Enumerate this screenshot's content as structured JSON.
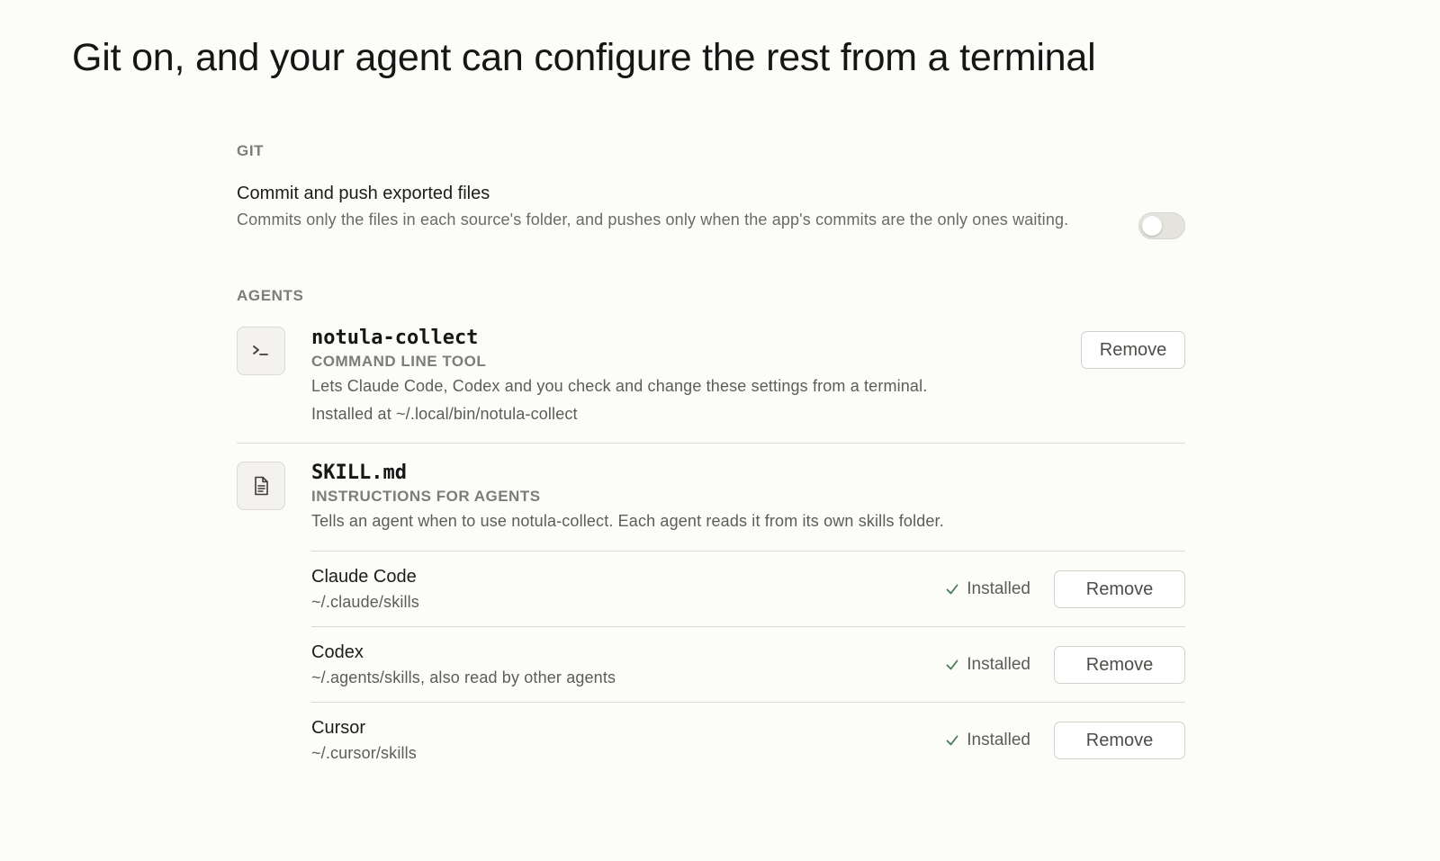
{
  "page": {
    "title": "Git on, and your agent can configure the rest from a terminal"
  },
  "git": {
    "section_label": "GIT",
    "setting_title": "Commit and push exported files",
    "setting_description": "Commits only the files in each source's folder, and pushes only when the app's commits are the only ones waiting.",
    "toggle_on": false
  },
  "agents": {
    "section_label": "AGENTS",
    "cli": {
      "icon": "terminal-icon",
      "name": "notula-collect",
      "subtitle": "COMMAND LINE TOOL",
      "description": "Lets Claude Code, Codex and you check and change these settings from a terminal.",
      "path": "Installed at ~/.local/bin/notula-collect",
      "remove_label": "Remove"
    },
    "skill": {
      "icon": "document-icon",
      "name": "SKILL.md",
      "subtitle": "INSTRUCTIONS FOR AGENTS",
      "description": "Tells an agent when to use notula-collect. Each agent reads it from its own skills folder.",
      "targets": [
        {
          "name": "Claude Code",
          "path": "~/.claude/skills",
          "status": "Installed",
          "remove_label": "Remove"
        },
        {
          "name": "Codex",
          "path": "~/.agents/skills, also read by other agents",
          "status": "Installed",
          "remove_label": "Remove"
        },
        {
          "name": "Cursor",
          "path": "~/.cursor/skills",
          "status": "Installed",
          "remove_label": "Remove"
        }
      ]
    }
  },
  "colors": {
    "background": "#fcfcf9",
    "muted_text": "#7e7c77",
    "divider": "#dcdad5",
    "check": "#4a7a52"
  }
}
